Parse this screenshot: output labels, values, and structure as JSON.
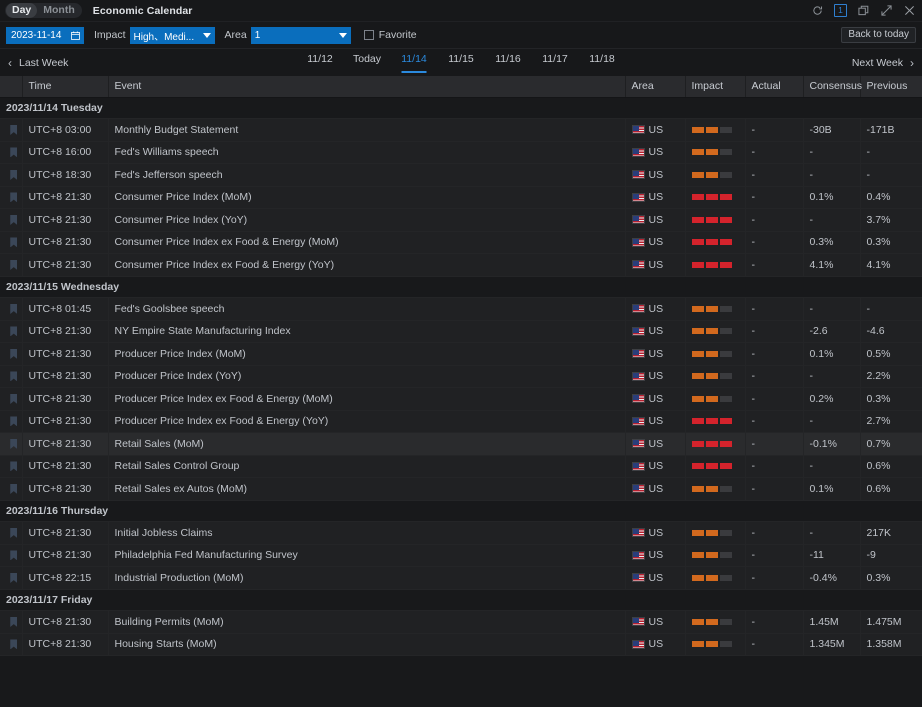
{
  "titlebar": {
    "segments": [
      {
        "label": "Day",
        "active": true
      },
      {
        "label": "Month",
        "active": false
      }
    ],
    "app_title": "Economic Calendar",
    "icons": [
      {
        "name": "refresh-icon",
        "glyph": "refresh"
      },
      {
        "name": "count-badge",
        "glyph": "1"
      },
      {
        "name": "restore-window-icon",
        "glyph": "restore"
      },
      {
        "name": "expand-icon",
        "glyph": "expand"
      },
      {
        "name": "close-icon",
        "glyph": "close"
      }
    ],
    "badge_count": "1"
  },
  "filterbar": {
    "date_value": "2023-11-14",
    "date_icon": "calendar-icon",
    "impact_label": "Impact",
    "impact_value": "High、Medi...",
    "area_label": "Area",
    "area_value": "1",
    "favorite_label": "Favorite",
    "favorite_checked": false,
    "back_to_today": "Back to today"
  },
  "weeknav": {
    "prev_label": "Last Week",
    "next_label": "Next Week",
    "tabs": [
      {
        "label": "11/12",
        "active": false
      },
      {
        "label": "Today",
        "active": false
      },
      {
        "label": "11/14",
        "active": true
      },
      {
        "label": "11/15",
        "active": false
      },
      {
        "label": "11/16",
        "active": false
      },
      {
        "label": "11/17",
        "active": false
      },
      {
        "label": "11/18",
        "active": false
      }
    ]
  },
  "table": {
    "columns": [
      "",
      "Time",
      "Event",
      "Area",
      "Impact",
      "Actual",
      "Consensus",
      "Previous"
    ],
    "groups": [
      {
        "date_label": "2023/11/14 Tuesday",
        "rows": [
          {
            "time": "UTC+8 03:00",
            "event": "Monthly Budget Statement",
            "area": "US",
            "impact": 2,
            "actual": "-",
            "consensus": "-30B",
            "previous": "-171B",
            "hover": false
          },
          {
            "time": "UTC+8 16:00",
            "event": "Fed's Williams speech",
            "area": "US",
            "impact": 2,
            "actual": "-",
            "consensus": "-",
            "previous": "-",
            "hover": false
          },
          {
            "time": "UTC+8 18:30",
            "event": "Fed's Jefferson speech",
            "area": "US",
            "impact": 2,
            "actual": "-",
            "consensus": "-",
            "previous": "-",
            "hover": false
          },
          {
            "time": "UTC+8 21:30",
            "event": "Consumer Price Index (MoM)",
            "area": "US",
            "impact": 3,
            "actual": "-",
            "consensus": "0.1%",
            "previous": "0.4%",
            "hover": false
          },
          {
            "time": "UTC+8 21:30",
            "event": "Consumer Price Index (YoY)",
            "area": "US",
            "impact": 3,
            "actual": "-",
            "consensus": "-",
            "previous": "3.7%",
            "hover": false
          },
          {
            "time": "UTC+8 21:30",
            "event": "Consumer Price Index ex Food & Energy (MoM)",
            "area": "US",
            "impact": 3,
            "actual": "-",
            "consensus": "0.3%",
            "previous": "0.3%",
            "hover": false
          },
          {
            "time": "UTC+8 21:30",
            "event": "Consumer Price Index ex Food & Energy (YoY)",
            "area": "US",
            "impact": 3,
            "actual": "-",
            "consensus": "4.1%",
            "previous": "4.1%",
            "hover": false
          }
        ]
      },
      {
        "date_label": "2023/11/15 Wednesday",
        "rows": [
          {
            "time": "UTC+8 01:45",
            "event": "Fed's Goolsbee speech",
            "area": "US",
            "impact": 2,
            "actual": "-",
            "consensus": "-",
            "previous": "-",
            "hover": false
          },
          {
            "time": "UTC+8 21:30",
            "event": "NY Empire State Manufacturing Index",
            "area": "US",
            "impact": 2,
            "actual": "-",
            "consensus": "-2.6",
            "previous": "-4.6",
            "hover": false
          },
          {
            "time": "UTC+8 21:30",
            "event": "Producer Price Index (MoM)",
            "area": "US",
            "impact": 2,
            "actual": "-",
            "consensus": "0.1%",
            "previous": "0.5%",
            "hover": false
          },
          {
            "time": "UTC+8 21:30",
            "event": "Producer Price Index (YoY)",
            "area": "US",
            "impact": 2,
            "actual": "-",
            "consensus": "-",
            "previous": "2.2%",
            "hover": false
          },
          {
            "time": "UTC+8 21:30",
            "event": "Producer Price Index ex Food & Energy (MoM)",
            "area": "US",
            "impact": 2,
            "actual": "-",
            "consensus": "0.2%",
            "previous": "0.3%",
            "hover": false
          },
          {
            "time": "UTC+8 21:30",
            "event": "Producer Price Index ex Food & Energy (YoY)",
            "area": "US",
            "impact": 3,
            "actual": "-",
            "consensus": "-",
            "previous": "2.7%",
            "hover": false
          },
          {
            "time": "UTC+8 21:30",
            "event": "Retail Sales (MoM)",
            "area": "US",
            "impact": 3,
            "actual": "-",
            "consensus": "-0.1%",
            "previous": "0.7%",
            "hover": true
          },
          {
            "time": "UTC+8 21:30",
            "event": "Retail Sales Control Group",
            "area": "US",
            "impact": 3,
            "actual": "-",
            "consensus": "-",
            "previous": "0.6%",
            "hover": false
          },
          {
            "time": "UTC+8 21:30",
            "event": "Retail Sales ex Autos (MoM)",
            "area": "US",
            "impact": 2,
            "actual": "-",
            "consensus": "0.1%",
            "previous": "0.6%",
            "hover": false
          }
        ]
      },
      {
        "date_label": "2023/11/16 Thursday",
        "rows": [
          {
            "time": "UTC+8 21:30",
            "event": "Initial Jobless Claims",
            "area": "US",
            "impact": 2,
            "actual": "-",
            "consensus": "-",
            "previous": "217K",
            "hover": false
          },
          {
            "time": "UTC+8 21:30",
            "event": "Philadelphia Fed Manufacturing Survey",
            "area": "US",
            "impact": 2,
            "actual": "-",
            "consensus": "-11",
            "previous": "-9",
            "hover": false
          },
          {
            "time": "UTC+8 22:15",
            "event": "Industrial Production (MoM)",
            "area": "US",
            "impact": 2,
            "actual": "-",
            "consensus": "-0.4%",
            "previous": "0.3%",
            "hover": false
          }
        ]
      },
      {
        "date_label": "2023/11/17 Friday",
        "rows": [
          {
            "time": "UTC+8 21:30",
            "event": "Building Permits (MoM)",
            "area": "US",
            "impact": 2,
            "actual": "-",
            "consensus": "1.45M",
            "previous": "1.475M",
            "hover": false
          },
          {
            "time": "UTC+8 21:30",
            "event": "Housing Starts (MoM)",
            "area": "US",
            "impact": 2,
            "actual": "-",
            "consensus": "1.345M",
            "previous": "1.358M",
            "hover": false
          }
        ]
      }
    ]
  },
  "colors": {
    "accent": "#2b8ade",
    "select_blue": "#0a6ebd",
    "impact_medium": "#d2691e",
    "impact_high": "#d4232c",
    "impact_off": "#3a3b3e",
    "bg": "#18191b",
    "row_bg": "#202123"
  }
}
